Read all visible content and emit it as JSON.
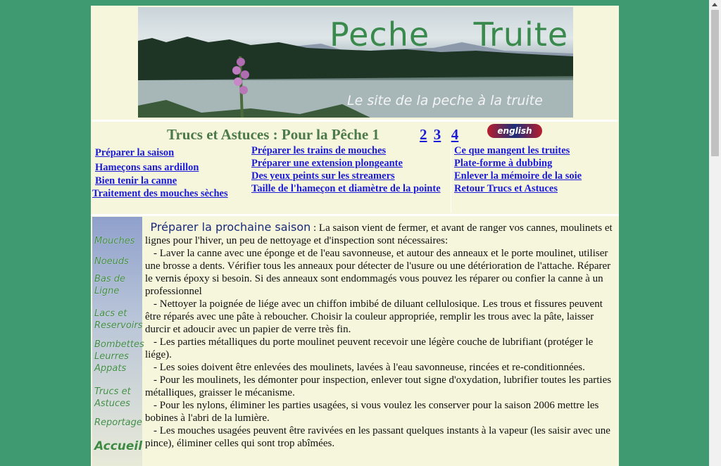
{
  "banner": {
    "title": "Peche    Truite",
    "subtitle": "Le site de la peche à la truite"
  },
  "heading": {
    "title": "Trucs et Astuces : Pour la Pêche 1",
    "pages": [
      "2",
      "3",
      "4"
    ],
    "flag_label": "english"
  },
  "links": {
    "col1": [
      "Préparer la saison ",
      "Hameçons sans ardillon",
      "Bien tenir la canne",
      " Traitement des mouches sèches"
    ],
    "col2": [
      "Préparer les trains de mouches ",
      "Préparer une extension plongeante ",
      "Des yeux peints sur les streamers ",
      "Taille de l'hameçon et diamètre de la pointe"
    ],
    "col3": [
      " Ce que mangent les truites",
      "Plate-forme à dubbing",
      " Enlever la mémoire de la soie ",
      "Retour Trucs et Astuces"
    ]
  },
  "sidebar": {
    "items": [
      "Mouches",
      "Noeuds",
      "Bas de Ligne",
      "Lacs et Reservoirs",
      "Bombettes Leurres Appats",
      "Trucs et Astuces",
      "Reportage",
      "Accueil"
    ]
  },
  "content": {
    "section_title": "Préparer  la prochaine saison",
    "intro": ": La saison vient de fermer, et avant de ranger vos cannes, moulinets et lignes pour l'hiver, un peu de nettoyage et d'inspection sont nécessaires:",
    "paragraphs": [
      "- Laver la canne avec une éponge et de l'eau savonneuse, et autour des anneaux et le porte moulinet, utiliser une brosse a dents. Vérifier tous les anneaux pour détecter de l'usure ou une détérioration de l'attache. Réparer le vernis époxy si besoin. Si des anneaux sont endommagés vous pouvez les réparer ou confier la canne à un professionnel",
      "- Nettoyer la poignée de liége avec un chiffon imbibé de diluant cellulosique. Les trous et fissures peuvent être réparés avec une pâte à reboucher. Choisir la couleur appropriée, remplir les trous avec la pâte, laisser durcir et adoucir avec un papier de verre très fin.",
      "- Les parties métalliques du porte moulinet peuvent recevoir une légère couche de lubrifiant (protéger le liége).",
      "- Les soies doivent être enlevées des moulinets, lavées à l'eau savonneuse, rincées et re-conditionnées.",
      "- Pour les moulinets, les démonter pour inspection, enlever tout signe d'oxydation, lubrifier toutes les parties métalliques, graisser le mécanisme.",
      "- Pour les nylons, éliminer les parties usagées, si vous voulez les conserver pour la saison 2006 mettre les bobines à l'abri de la lumière.",
      "- Les mouches usagées peuvent être ravivées en  les passant quelques instants à la vapeur (les saisir avec une pince), éliminer celles qui sont trop abîmées."
    ]
  }
}
